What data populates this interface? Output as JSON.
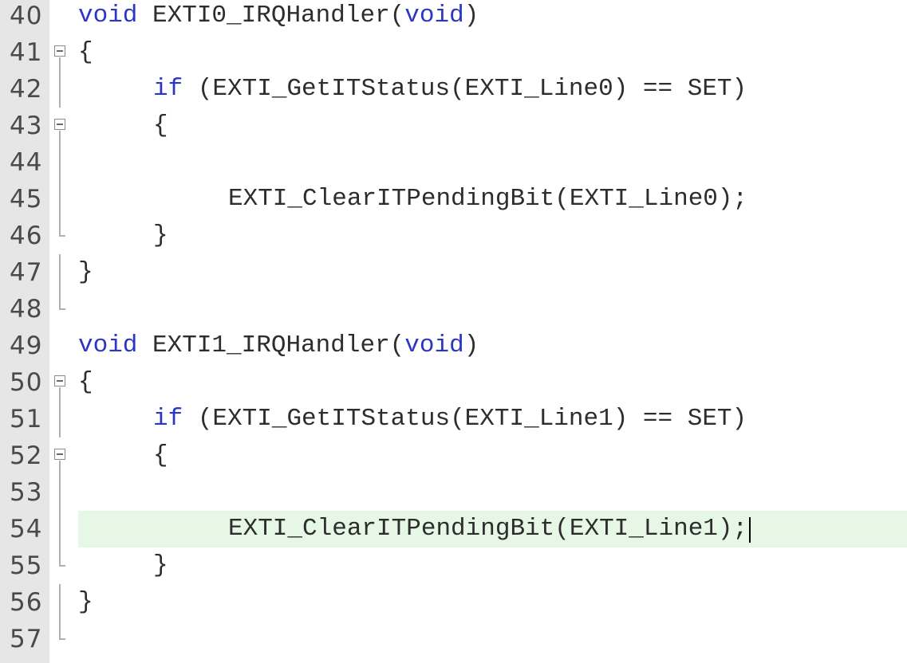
{
  "editor": {
    "highlight_color": "#e6f7e6",
    "keyword_color": "#2b35c8",
    "gutter_color": "#e6e6e6",
    "lines": [
      {
        "num": "40",
        "fold": "none",
        "indent": 0,
        "tokens": [
          {
            "t": "void",
            "k": true
          },
          {
            "t": " EXTI0_IRQHandler("
          },
          {
            "t": "void",
            "k": true
          },
          {
            "t": ")"
          }
        ]
      },
      {
        "num": "41",
        "fold": "open",
        "indent": 0,
        "tokens": [
          {
            "t": "{"
          }
        ]
      },
      {
        "num": "42",
        "fold": "line",
        "indent": 1,
        "tokens": [
          {
            "t": "if",
            "k": true
          },
          {
            "t": " (EXTI_GetITStatus(EXTI_Line0) == SET)"
          }
        ]
      },
      {
        "num": "43",
        "fold": "open",
        "indent": 1,
        "tokens": [
          {
            "t": "{"
          }
        ]
      },
      {
        "num": "44",
        "fold": "line",
        "indent": 0,
        "tokens": []
      },
      {
        "num": "45",
        "fold": "line",
        "indent": 2,
        "tokens": [
          {
            "t": "EXTI_ClearITPendingBit(EXTI_Line0);"
          }
        ]
      },
      {
        "num": "46",
        "fold": "end",
        "indent": 1,
        "tokens": [
          {
            "t": "}"
          }
        ]
      },
      {
        "num": "47",
        "fold": "line",
        "indent": 0,
        "tokens": [
          {
            "t": "}"
          }
        ]
      },
      {
        "num": "48",
        "fold": "end",
        "indent": 0,
        "tokens": []
      },
      {
        "num": "49",
        "fold": "none",
        "indent": 0,
        "tokens": [
          {
            "t": "void",
            "k": true
          },
          {
            "t": " EXTI1_IRQHandler("
          },
          {
            "t": "void",
            "k": true
          },
          {
            "t": ")"
          }
        ]
      },
      {
        "num": "50",
        "fold": "open",
        "indent": 0,
        "tokens": [
          {
            "t": "{"
          }
        ]
      },
      {
        "num": "51",
        "fold": "line",
        "indent": 1,
        "tokens": [
          {
            "t": "if",
            "k": true
          },
          {
            "t": " (EXTI_GetITStatus(EXTI_Line1) == SET)"
          }
        ]
      },
      {
        "num": "52",
        "fold": "open",
        "indent": 1,
        "tokens": [
          {
            "t": "{"
          }
        ]
      },
      {
        "num": "53",
        "fold": "line",
        "indent": 0,
        "tokens": []
      },
      {
        "num": "54",
        "fold": "line",
        "indent": 2,
        "current": true,
        "tokens": [
          {
            "t": "EXTI_ClearITPendingBit(EXTI_Line1);"
          }
        ]
      },
      {
        "num": "55",
        "fold": "end",
        "indent": 1,
        "tokens": [
          {
            "t": "}"
          }
        ]
      },
      {
        "num": "56",
        "fold": "line",
        "indent": 0,
        "tokens": [
          {
            "t": "}"
          }
        ]
      },
      {
        "num": "57",
        "fold": "end",
        "indent": 0,
        "tokens": []
      }
    ]
  }
}
